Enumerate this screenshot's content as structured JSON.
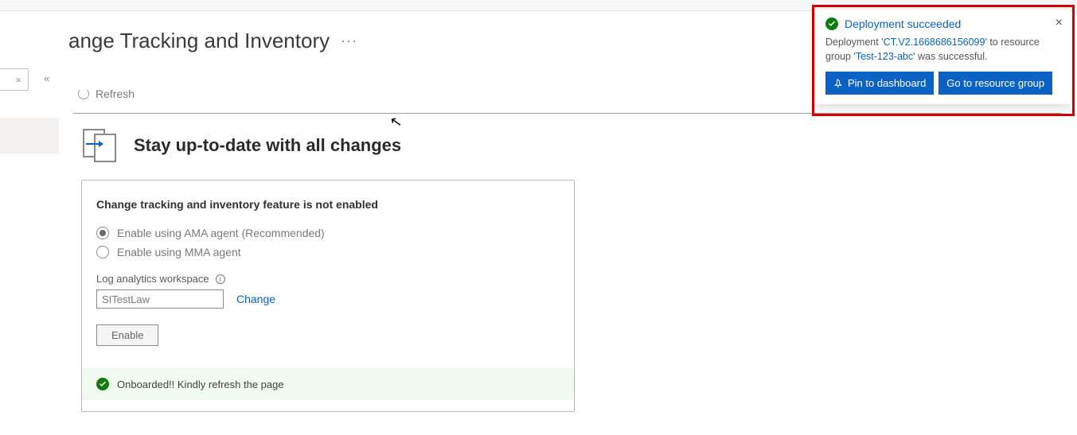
{
  "header": {
    "title": "ange Tracking and Inventory",
    "more": "···"
  },
  "toolbar": {
    "refresh_label": "Refresh"
  },
  "panel": {
    "heading": "Stay up-to-date with all changes",
    "card_title": "Change tracking and inventory feature is not enabled",
    "radios": {
      "ama": "Enable using AMA agent (Recommended)",
      "mma": "Enable using MMA agent"
    },
    "workspace_label": "Log analytics workspace",
    "workspace_value": "SITestLaw",
    "change_link": "Change",
    "enable_button": "Enable",
    "status_message": "Onboarded!! Kindly refresh the page"
  },
  "toast": {
    "title": "Deployment succeeded",
    "body_prefix": "Deployment '",
    "deployment_name": "CT.V2.1668686156099",
    "body_mid": "' to resource group '",
    "resource_group": "Test-123-abc",
    "body_suffix": "' was successful.",
    "pin_button": "Pin to dashboard",
    "go_button": "Go to resource group"
  }
}
